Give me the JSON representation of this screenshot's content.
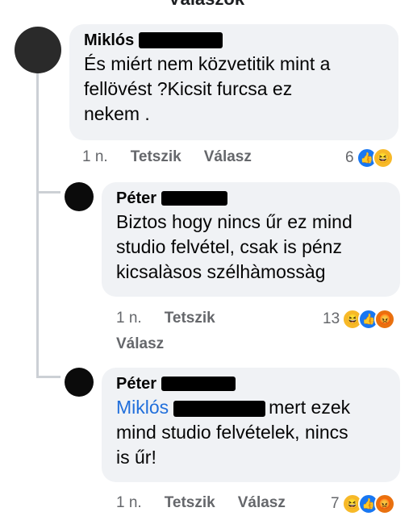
{
  "header": {
    "title": "Válaszok"
  },
  "comments": [
    {
      "author": "Miklós",
      "text_lines": [
        "És miért nem közvetitik mint a",
        "fellövést ?Kicsit furcsa ez",
        "nekem ."
      ],
      "time": "1 n.",
      "like_label": "Tetszik",
      "reply_label": "Válasz",
      "reaction_count": "6",
      "reactions": [
        "like-icon",
        "haha-icon"
      ]
    },
    {
      "author": "Péter",
      "text_lines": [
        "Biztos hogy nincs űr ez mind",
        "studio felvétel, csak is pénz",
        "kicsalàsos szélhàmossàg"
      ],
      "time": "1 n.",
      "like_label": "Tetszik",
      "reply_label": "Válasz",
      "reaction_count": "13",
      "reactions": [
        "haha-icon",
        "like-icon",
        "angry-icon"
      ]
    },
    {
      "author": "Péter",
      "mention": "Miklós",
      "text_first_rest": "mert ezek",
      "text_lines": [
        "mind studio felvételek, nincs",
        "is űr!"
      ],
      "time": "1 n.",
      "like_label": "Tetszik",
      "reply_label": "Válasz",
      "reaction_count": "7",
      "reactions": [
        "haha-icon",
        "like-icon",
        "angry-icon"
      ]
    }
  ],
  "colors": {
    "bubble": "#f0f2f5",
    "mention": "#216fdb",
    "meta": "#65676b",
    "like": "#1877f2",
    "haha": "#f7b928",
    "angry": "#e9710f"
  }
}
